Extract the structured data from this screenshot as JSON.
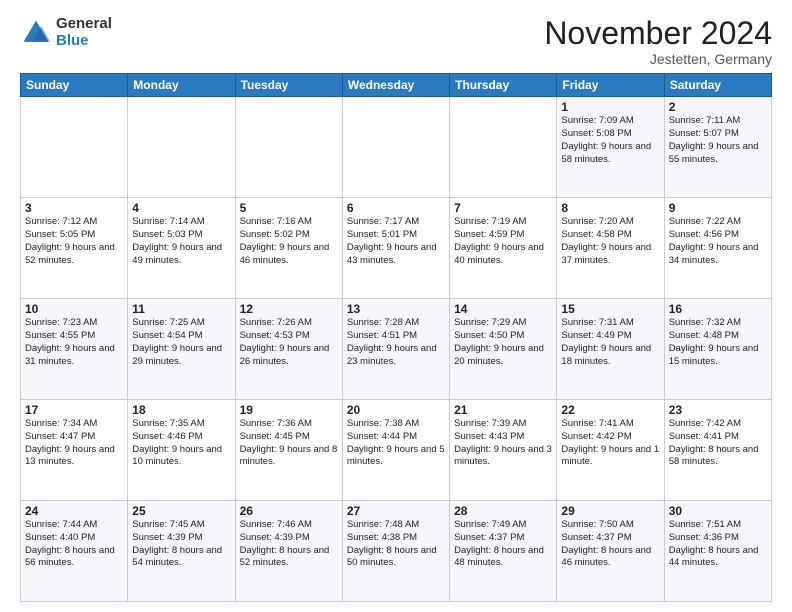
{
  "logo": {
    "general": "General",
    "blue": "Blue"
  },
  "header": {
    "month": "November 2024",
    "location": "Jestetten, Germany"
  },
  "weekdays": [
    "Sunday",
    "Monday",
    "Tuesday",
    "Wednesday",
    "Thursday",
    "Friday",
    "Saturday"
  ],
  "rows": [
    [
      {
        "day": "",
        "info": ""
      },
      {
        "day": "",
        "info": ""
      },
      {
        "day": "",
        "info": ""
      },
      {
        "day": "",
        "info": ""
      },
      {
        "day": "",
        "info": ""
      },
      {
        "day": "1",
        "info": "Sunrise: 7:09 AM\nSunset: 5:08 PM\nDaylight: 9 hours and 58 minutes."
      },
      {
        "day": "2",
        "info": "Sunrise: 7:11 AM\nSunset: 5:07 PM\nDaylight: 9 hours and 55 minutes."
      }
    ],
    [
      {
        "day": "3",
        "info": "Sunrise: 7:12 AM\nSunset: 5:05 PM\nDaylight: 9 hours and 52 minutes."
      },
      {
        "day": "4",
        "info": "Sunrise: 7:14 AM\nSunset: 5:03 PM\nDaylight: 9 hours and 49 minutes."
      },
      {
        "day": "5",
        "info": "Sunrise: 7:16 AM\nSunset: 5:02 PM\nDaylight: 9 hours and 46 minutes."
      },
      {
        "day": "6",
        "info": "Sunrise: 7:17 AM\nSunset: 5:01 PM\nDaylight: 9 hours and 43 minutes."
      },
      {
        "day": "7",
        "info": "Sunrise: 7:19 AM\nSunset: 4:59 PM\nDaylight: 9 hours and 40 minutes."
      },
      {
        "day": "8",
        "info": "Sunrise: 7:20 AM\nSunset: 4:58 PM\nDaylight: 9 hours and 37 minutes."
      },
      {
        "day": "9",
        "info": "Sunrise: 7:22 AM\nSunset: 4:56 PM\nDaylight: 9 hours and 34 minutes."
      }
    ],
    [
      {
        "day": "10",
        "info": "Sunrise: 7:23 AM\nSunset: 4:55 PM\nDaylight: 9 hours and 31 minutes."
      },
      {
        "day": "11",
        "info": "Sunrise: 7:25 AM\nSunset: 4:54 PM\nDaylight: 9 hours and 29 minutes."
      },
      {
        "day": "12",
        "info": "Sunrise: 7:26 AM\nSunset: 4:53 PM\nDaylight: 9 hours and 26 minutes."
      },
      {
        "day": "13",
        "info": "Sunrise: 7:28 AM\nSunset: 4:51 PM\nDaylight: 9 hours and 23 minutes."
      },
      {
        "day": "14",
        "info": "Sunrise: 7:29 AM\nSunset: 4:50 PM\nDaylight: 9 hours and 20 minutes."
      },
      {
        "day": "15",
        "info": "Sunrise: 7:31 AM\nSunset: 4:49 PM\nDaylight: 9 hours and 18 minutes."
      },
      {
        "day": "16",
        "info": "Sunrise: 7:32 AM\nSunset: 4:48 PM\nDaylight: 9 hours and 15 minutes."
      }
    ],
    [
      {
        "day": "17",
        "info": "Sunrise: 7:34 AM\nSunset: 4:47 PM\nDaylight: 9 hours and 13 minutes."
      },
      {
        "day": "18",
        "info": "Sunrise: 7:35 AM\nSunset: 4:46 PM\nDaylight: 9 hours and 10 minutes."
      },
      {
        "day": "19",
        "info": "Sunrise: 7:36 AM\nSunset: 4:45 PM\nDaylight: 9 hours and 8 minutes."
      },
      {
        "day": "20",
        "info": "Sunrise: 7:38 AM\nSunset: 4:44 PM\nDaylight: 9 hours and 5 minutes."
      },
      {
        "day": "21",
        "info": "Sunrise: 7:39 AM\nSunset: 4:43 PM\nDaylight: 9 hours and 3 minutes."
      },
      {
        "day": "22",
        "info": "Sunrise: 7:41 AM\nSunset: 4:42 PM\nDaylight: 9 hours and 1 minute."
      },
      {
        "day": "23",
        "info": "Sunrise: 7:42 AM\nSunset: 4:41 PM\nDaylight: 8 hours and 58 minutes."
      }
    ],
    [
      {
        "day": "24",
        "info": "Sunrise: 7:44 AM\nSunset: 4:40 PM\nDaylight: 8 hours and 56 minutes."
      },
      {
        "day": "25",
        "info": "Sunrise: 7:45 AM\nSunset: 4:39 PM\nDaylight: 8 hours and 54 minutes."
      },
      {
        "day": "26",
        "info": "Sunrise: 7:46 AM\nSunset: 4:39 PM\nDaylight: 8 hours and 52 minutes."
      },
      {
        "day": "27",
        "info": "Sunrise: 7:48 AM\nSunset: 4:38 PM\nDaylight: 8 hours and 50 minutes."
      },
      {
        "day": "28",
        "info": "Sunrise: 7:49 AM\nSunset: 4:37 PM\nDaylight: 8 hours and 48 minutes."
      },
      {
        "day": "29",
        "info": "Sunrise: 7:50 AM\nSunset: 4:37 PM\nDaylight: 8 hours and 46 minutes."
      },
      {
        "day": "30",
        "info": "Sunrise: 7:51 AM\nSunset: 4:36 PM\nDaylight: 8 hours and 44 minutes."
      }
    ]
  ]
}
